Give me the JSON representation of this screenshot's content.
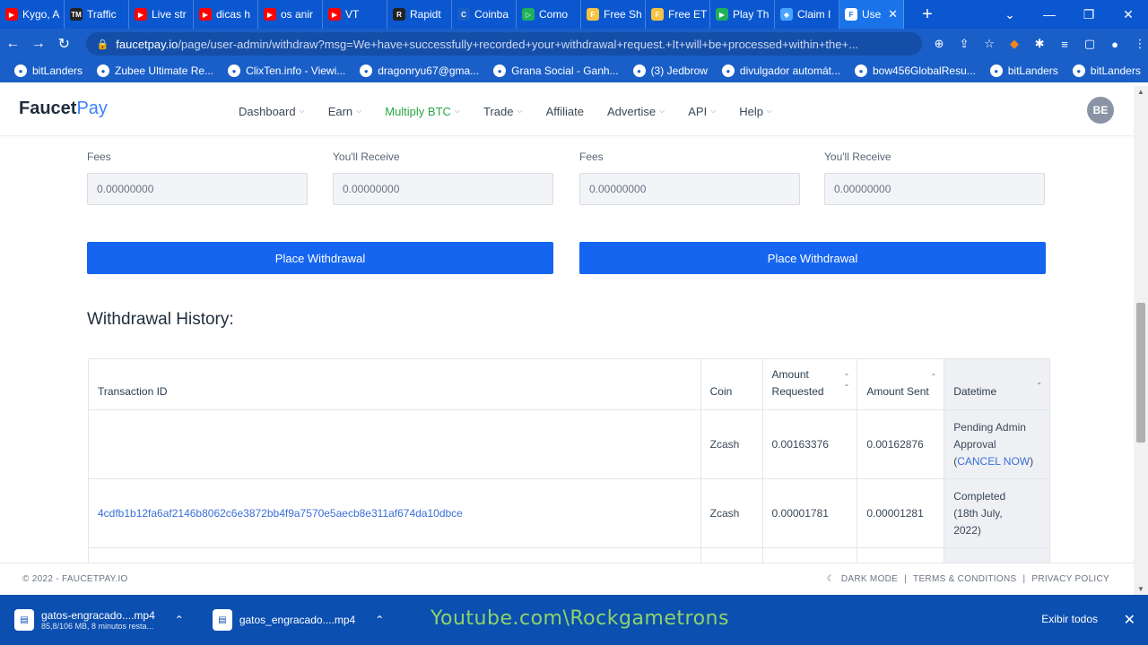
{
  "browser": {
    "tabs": [
      {
        "label": "Kygo, A",
        "fav_color": "#ff0000",
        "fav": "▶"
      },
      {
        "label": "Traffic",
        "fav_color": "#222222",
        "fav": "TM"
      },
      {
        "label": "Live str",
        "fav_color": "#ff0000",
        "fav": "▶"
      },
      {
        "label": "dicas h",
        "fav_color": "#ff0000",
        "fav": "▶"
      },
      {
        "label": "os anir",
        "fav_color": "#ff0000",
        "fav": "▶"
      },
      {
        "label": "VT",
        "fav_color": "#ff0000",
        "fav": "▶"
      },
      {
        "label": "Rapidt",
        "fav_color": "#222222",
        "fav": "R"
      },
      {
        "label": "Coinba",
        "fav_color": "#1a5fc8",
        "fav": "C"
      },
      {
        "label": "Como",
        "fav_color": "#1fb05a",
        "fav": "▷"
      },
      {
        "label": "Free Sh",
        "fav_color": "#f6c343",
        "fav": "F"
      },
      {
        "label": "Free ET",
        "fav_color": "#f6c343",
        "fav": "F"
      },
      {
        "label": "Play Th",
        "fav_color": "#1fb05a",
        "fav": "▶"
      },
      {
        "label": "Claim I",
        "fav_color": "#4aa3ff",
        "fav": "◆"
      },
      {
        "label": "Use",
        "fav_color": "#ffffff",
        "fav": "F"
      }
    ],
    "url_host": "faucetpay.io",
    "url_path": "/page/user-admin/withdraw?msg=We+have+successfully+recorded+your+withdrawal+request.+It+will+be+processed+within+the+...",
    "bookmarks": [
      "bitLanders",
      "Zubee Ultimate Re...",
      "ClixTen.info - Viewi...",
      "dragonryu67@gma...",
      "Grana Social - Ganh...",
      "(3) Jedbrow",
      "divulgador automát...",
      "bow456GlobalResu...",
      "bitLanders",
      "bitLanders"
    ]
  },
  "site": {
    "logo_a": "Faucet",
    "logo_b": "Pay",
    "menu": {
      "dashboard": "Dashboard",
      "earn": "Earn",
      "multiply": "Multiply BTC",
      "trade": "Trade",
      "affiliate": "Affiliate",
      "advertise": "Advertise",
      "api": "API",
      "help": "Help"
    },
    "avatar": "BE"
  },
  "form": {
    "fees_label": "Fees",
    "receive_label": "You'll Receive",
    "left_fees": "0.00000000",
    "left_receive": "0.00000000",
    "right_fees": "0.00000000",
    "right_receive": "0.00000000",
    "place_button": "Place Withdrawal"
  },
  "history": {
    "title": "Withdrawal History:",
    "headers": {
      "txid": "Transaction ID",
      "coin": "Coin",
      "amount_requested_1": "Amount",
      "amount_requested_2": "Requested",
      "amount_sent": "Amount Sent",
      "datetime": "Datetime"
    },
    "rows": [
      {
        "txid": "",
        "coin": "Zcash",
        "requested": "0.00163376",
        "sent": "0.00162876",
        "status_1": "Pending Admin",
        "status_2": "Approval",
        "status_3_open": "(",
        "cancel": "CANCEL NOW",
        "status_3_close": ")"
      },
      {
        "txid": "4cdfb1b12fa6af2146b8062c6e3872bb4f9a7570e5aecb8e311af674da10dbce",
        "coin": "Zcash",
        "requested": "0.00001781",
        "sent": "0.00001281",
        "status_1": "Completed",
        "status_2": "(18th July,",
        "status_3": "2022)"
      }
    ]
  },
  "footer": {
    "copyright": "© 2022 - FAUCETPAY.IO",
    "dark_mode": "DARK MODE",
    "terms": "TERMS & CONDITIONS",
    "privacy": "PRIVACY POLICY"
  },
  "downloads": {
    "item1_name": "gatos-engracado....mp4",
    "item1_sub": "85,8/106 MB, 8 minutos resta...",
    "item2_name": "gatos_engracado....mp4",
    "show_all": "Exibir todos"
  },
  "watermark": "Youtube.com\\Rockgametrons"
}
